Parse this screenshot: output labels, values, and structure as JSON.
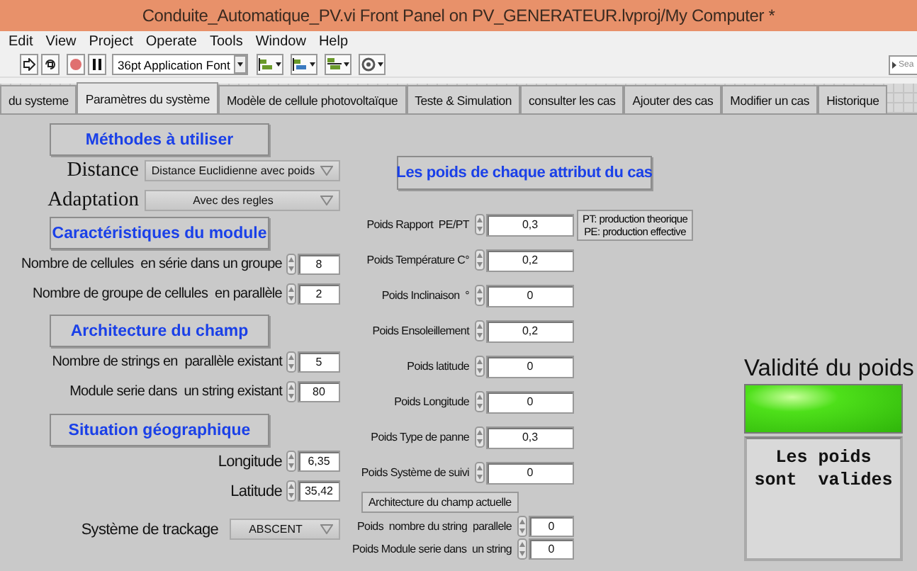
{
  "window": {
    "title": "Conduite_Automatique_PV.vi Front Panel on PV_GENERATEUR.lvproj/My Computer *"
  },
  "menu": [
    "Edit",
    "View",
    "Project",
    "Operate",
    "Tools",
    "Window",
    "Help"
  ],
  "toolbar": {
    "font": "36pt Application Font",
    "search": {
      "placeholder": "Sea"
    }
  },
  "tabs": [
    {
      "label": "du systeme",
      "selected": false
    },
    {
      "label": "Paramètres du système",
      "selected": true
    },
    {
      "label": "Modèle de cellule photovoltaïque",
      "selected": false
    },
    {
      "label": "Teste & Simulation",
      "selected": false
    },
    {
      "label": "consulter les cas",
      "selected": false
    },
    {
      "label": "Ajouter des cas",
      "selected": false
    },
    {
      "label": "Modifier un cas",
      "selected": false
    },
    {
      "label": "Historique",
      "selected": false
    }
  ],
  "left_sections": [
    {
      "heading": "Méthodes à utiliser",
      "controls": [
        {
          "kind": "ring",
          "label": "Distance",
          "value": "Distance Euclidienne avec poids"
        },
        {
          "kind": "ring",
          "label": "Adaptation",
          "value": "Avec des regles"
        }
      ]
    },
    {
      "heading": "Caractéristiques du module",
      "controls": [
        {
          "kind": "numeric",
          "label": "Nombre de cellules  en série dans un groupe",
          "value": "8"
        },
        {
          "kind": "numeric",
          "label": "Nombre de groupe de cellules  en parallèle",
          "value": "2"
        }
      ]
    },
    {
      "heading": "Architecture du champ",
      "controls": [
        {
          "kind": "numeric",
          "label": "Nombre de strings en  parallèle existant",
          "value": "5"
        },
        {
          "kind": "numeric",
          "label": "Module serie dans  un string existant",
          "value": "80"
        }
      ]
    },
    {
      "heading": "Situation géographique",
      "controls": [
        {
          "kind": "numeric",
          "label": "Longitude",
          "value": "6,35"
        },
        {
          "kind": "numeric",
          "label": "Latitude",
          "value": "35,42"
        },
        {
          "kind": "enum",
          "label": "Système de trackage",
          "value": "ABSCENT"
        }
      ]
    }
  ],
  "weights": {
    "heading": "Les poids de chaque attribut du cas",
    "items": [
      {
        "kind": "numeric",
        "label": "Poids Rapport  PE/PT",
        "value": "0,3",
        "note": [
          "PT: production theorique",
          "PE: production effective"
        ]
      },
      {
        "kind": "numeric",
        "label": "Poids Température C°",
        "value": "0,2"
      },
      {
        "kind": "numeric",
        "label": "Poids Inclinaison  °",
        "value": "0"
      },
      {
        "kind": "numeric",
        "label": "Poids Ensoleillement",
        "value": "0,2"
      },
      {
        "kind": "numeric",
        "label": "Poids latitude",
        "value": "0"
      },
      {
        "kind": "numeric",
        "label": "Poids Longitude",
        "value": "0"
      },
      {
        "kind": "numeric",
        "label": "Poids Type de panne",
        "value": "0,3"
      },
      {
        "kind": "numeric",
        "label": "Poids Système de suivi",
        "value": "0"
      },
      {
        "kind": "button",
        "label": "Architecture du champ actuelle"
      },
      {
        "kind": "compact",
        "label": "Poids  nombre du string  parallele",
        "value": "0"
      },
      {
        "kind": "compact",
        "label": "Poids Module serie dans  un string",
        "value": "0"
      }
    ]
  },
  "validity": {
    "title": "Validité du poids",
    "led_on": true,
    "message": [
      "Les poids",
      "sont  valides"
    ]
  }
}
